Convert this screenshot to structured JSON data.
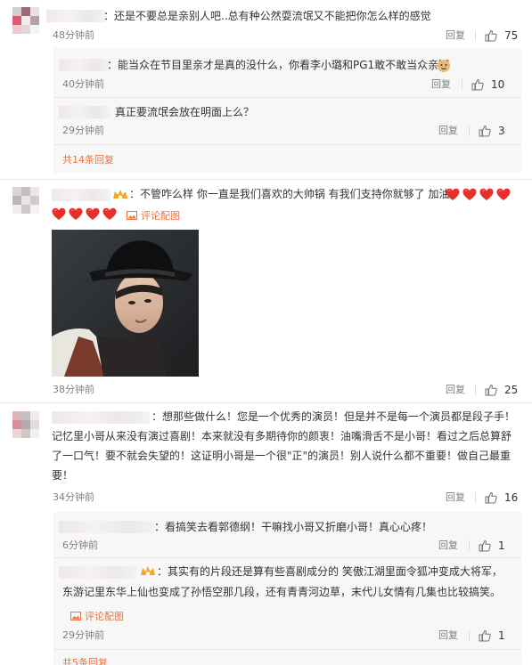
{
  "comments": [
    {
      "text": "：还是不要总是亲别人吧..总有种公然耍流氓又不能把你怎么样的感觉",
      "time": "48分钟前",
      "reply_label": "回复",
      "likes": "75",
      "subreplies": [
        {
          "text": "：能当众在节目里亲才是真的没什么，你看李小璐和PG1敢不敢当众亲",
          "time": "40分钟前",
          "reply_label": "回复",
          "likes": "10"
        },
        {
          "text": "真正要流氓会放在明面上么？",
          "time": "29分钟前",
          "reply_label": "回复",
          "likes": "3"
        }
      ],
      "more_replies": "共14条回复"
    },
    {
      "text": "：不管咋么样 你一直是我们喜欢的大帅锅 有我们支持你就够了 加油",
      "pic_link": "评论配图",
      "time": "38分钟前",
      "reply_label": "回复",
      "likes": "25"
    },
    {
      "lines": [
        "：想那些做什么！您是一个优秀的演员！但是并不是每一个演员都是段子手！",
        "记忆里小哥从来没有演过喜剧！本来就没有多期待你的颜衷！油嘴滑舌不是小哥！看过之后总算舒",
        "了一口气！要不就会失望的！这证明小哥是一个很\"正\"的演员！别人说什么都不重要！做自己最重",
        "要！"
      ],
      "time": "34分钟前",
      "reply_label": "回复",
      "likes": "16",
      "subreplies": [
        {
          "text": "：看搞笑去看郭德纲！干嘛找小哥又折磨小哥！真心心疼！",
          "time": "6分钟前",
          "reply_label": "回复",
          "likes": "1"
        },
        {
          "lines": [
            "：其实有的片段还是算有些喜剧成分的 笑傲江湖里面令狐冲变成大将军，",
            "东游记里东华上仙也变成了孙悟空那几段，还有青青河边草，末代儿女情有几集也比较搞笑。"
          ],
          "pic_link": "评论配图",
          "time": "29分钟前",
          "reply_label": "回复",
          "likes": "1"
        }
      ],
      "more_replies": "共5条回复"
    }
  ],
  "colors": {
    "accent": "#eb7340",
    "meta": "#808080",
    "panel": "#f7f7f7"
  }
}
